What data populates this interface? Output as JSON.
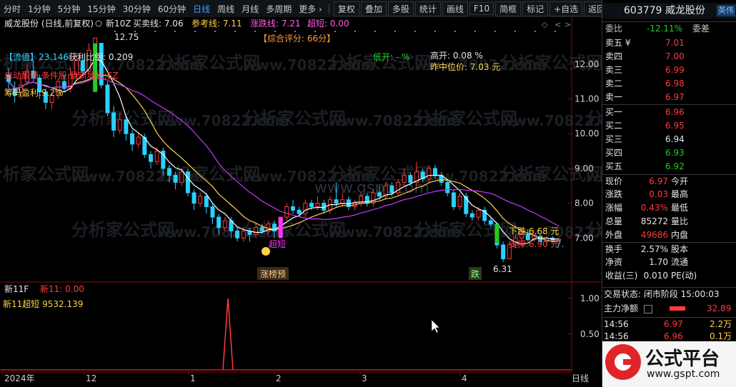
{
  "toolbar": {
    "periods": [
      "分时",
      "1分钟",
      "5分钟",
      "15分钟",
      "30分钟",
      "60分钟",
      "日线",
      "周线",
      "月线",
      "多周期",
      "更多 ›"
    ],
    "active_period": "日线",
    "tools": [
      "复权",
      "叠加",
      "多股",
      "统计",
      "画线",
      "F10",
      "简框",
      "标记",
      "+自选",
      "返回"
    ]
  },
  "chart_header": {
    "title": "威龙股份 (日线,前复权)",
    "indicator": "新10Z",
    "buy_sell_label": "买卖线: 7.06",
    "ref_label": "参考线: 7.11",
    "zdx_label": "涨跌线: 7.21",
    "super_label": "超短: 0.00"
  },
  "annotations": {
    "float_cap": "【流值】23.146",
    "profit_ratio": "获利比例: 0.209",
    "concepts": "启动酿酒 条件股 最新地址:SZ",
    "chip_profit": "筹码盈利:9.2%",
    "score": "【综合评分: 66分】",
    "low_open": "低开: - %",
    "high_open": "高开: 0.08 %",
    "prev_median": "昨中位价: 7.03 元",
    "high_mark": "12.75",
    "low_mark": "6.31",
    "super_short": "超短",
    "limit_list": "涨榜预",
    "drop_label": "跌",
    "drop_price": "下跌:6.68 元",
    "support_price": "支撑:6.90 元",
    "right_price": "7."
  },
  "watermarks": [
    "分析家公式网",
    "www.70822.com"
  ],
  "gspt_watermark": "www.gspt.com",
  "price_axis": [
    "12.00",
    "11.00",
    "10.00",
    "9.00",
    "8.00",
    "7.00"
  ],
  "sub_header": {
    "name": "新11F",
    "value": "新11: 0.00",
    "line2": "新11超短 9532.139"
  },
  "sub_axis": [
    "1.00",
    "0.50"
  ],
  "date_axis": [
    "2024年",
    "12",
    "1",
    "2",
    "3",
    "4",
    "日线"
  ],
  "quote": {
    "code_name": "603779 威龙股份",
    "badge": "英伟",
    "weibi_label": "委比",
    "weibi_value": "-12.11%",
    "weicha_label": "委差",
    "asks": [
      {
        "label": "卖五 ¥",
        "price": "7.01"
      },
      {
        "label": "卖四",
        "price": "7.00"
      },
      {
        "label": "卖三",
        "price": "6.99"
      },
      {
        "label": "卖二",
        "price": "6.98"
      },
      {
        "label": "卖一",
        "price": "6.97"
      }
    ],
    "bids": [
      {
        "label": "买一",
        "price": "6.96"
      },
      {
        "label": "买二",
        "price": "6.95"
      },
      {
        "label": "买三",
        "price": "6.94"
      },
      {
        "label": "买四",
        "price": "6.93"
      },
      {
        "label": "买五",
        "price": "6.92"
      }
    ],
    "stats": [
      {
        "l1": "现价",
        "v1": "6.97",
        "l2": "今开"
      },
      {
        "l1": "涨跌",
        "v1": "0.03",
        "l2": "最高"
      },
      {
        "l1": "涨幅",
        "v1": "0.43%",
        "l2": "最低"
      },
      {
        "l1": "总量",
        "v1": "85272",
        "l2": "量比"
      },
      {
        "l1": "外盘",
        "v1": "49686",
        "l2": "内盘"
      },
      {
        "l1": "换手",
        "v1": "2.57%",
        "l2": "股本"
      },
      {
        "l1": "净资",
        "v1": "1.70",
        "l2": "流通"
      },
      {
        "l1": "收益(三)",
        "v1": "0.010",
        "l2": "PE(动)"
      }
    ],
    "trade_status": "交易状态: 闭市阶段 15:00:03",
    "net_flow_label": "主力净额",
    "net_flow_value": "32.89",
    "ticks": [
      {
        "time": "14:56",
        "price": "6.97",
        "vol": "2.2万"
      },
      {
        "time": "14:56",
        "price": "6.96",
        "vol": "0.1万"
      }
    ],
    "logo_text": "公式平台",
    "logo_url": "www.gspt.com"
  },
  "chart_data": {
    "type": "candlestick",
    "series": [
      {
        "name": "买卖线",
        "values": []
      },
      {
        "name": "参考线",
        "values": []
      },
      {
        "name": "涨跌线",
        "values": []
      }
    ],
    "candles": [
      [
        11.7,
        11.5,
        11.9,
        11.3
      ],
      [
        11.3,
        11.1,
        11.5,
        10.9
      ],
      [
        11.2,
        11.4,
        11.6,
        11.0
      ],
      [
        11.5,
        11.8,
        12.0,
        11.4
      ],
      [
        11.8,
        11.6,
        12.1,
        11.5
      ],
      [
        11.6,
        11.2,
        11.7,
        11.0
      ],
      [
        11.2,
        10.9,
        11.3,
        10.7
      ],
      [
        10.9,
        11.1,
        11.2,
        10.7
      ],
      [
        11.1,
        11.5,
        11.6,
        11.0
      ],
      [
        11.5,
        11.3,
        11.7,
        11.2
      ],
      [
        11.3,
        11.7,
        11.9,
        11.2
      ],
      [
        11.7,
        12.1,
        12.3,
        11.6
      ],
      [
        12.1,
        11.8,
        12.3,
        11.7
      ],
      [
        11.8,
        12.4,
        12.6,
        11.7
      ],
      [
        12.4,
        12.75,
        12.75,
        12.2
      ],
      [
        12.6,
        11.4,
        12.6,
        11.3
      ],
      [
        11.4,
        10.6,
        11.5,
        10.5
      ],
      [
        10.6,
        10.1,
        10.8,
        9.9
      ],
      [
        10.1,
        10.4,
        10.6,
        10.0
      ],
      [
        10.4,
        10.0,
        10.5,
        9.8
      ],
      [
        10.0,
        9.7,
        10.1,
        9.5
      ],
      [
        9.7,
        9.9,
        10.0,
        9.6
      ],
      [
        9.9,
        9.4,
        10.0,
        9.3
      ],
      [
        9.4,
        9.2,
        9.5,
        9.0
      ],
      [
        9.2,
        9.5,
        9.6,
        9.1
      ],
      [
        9.5,
        9.0,
        9.6,
        8.8
      ],
      [
        9.0,
        8.8,
        9.1,
        8.6
      ],
      [
        8.8,
        8.6,
        8.9,
        8.4
      ],
      [
        8.6,
        8.9,
        9.0,
        8.5
      ],
      [
        8.9,
        8.3,
        9.0,
        8.2
      ],
      [
        8.3,
        8.0,
        8.4,
        7.8
      ],
      [
        8.0,
        8.2,
        8.3,
        7.9
      ],
      [
        8.2,
        7.9,
        8.3,
        7.7
      ],
      [
        7.9,
        7.6,
        8.0,
        7.4
      ],
      [
        7.6,
        7.3,
        7.7,
        7.1
      ],
      [
        7.3,
        7.5,
        7.6,
        7.2
      ],
      [
        7.5,
        7.2,
        7.6,
        7.0
      ],
      [
        7.2,
        7.0,
        7.3,
        6.9
      ],
      [
        7.0,
        7.2,
        7.3,
        6.9
      ],
      [
        7.2,
        7.1,
        7.3,
        6.9
      ],
      [
        7.1,
        7.3,
        7.4,
        7.0
      ],
      [
        7.3,
        7.2,
        7.4,
        7.1
      ],
      [
        7.2,
        7.4,
        7.5,
        7.1
      ],
      [
        7.4,
        7.2,
        7.5,
        7.0
      ],
      [
        7.1,
        7.6,
        7.6,
        7.0
      ],
      [
        7.6,
        7.9,
        8.0,
        7.5
      ],
      [
        7.9,
        7.8,
        8.1,
        7.7
      ],
      [
        7.8,
        7.7,
        7.9,
        7.6
      ],
      [
        7.7,
        8.0,
        8.1,
        7.6
      ],
      [
        8.0,
        7.9,
        8.1,
        7.8
      ],
      [
        7.9,
        8.0,
        8.2,
        7.8
      ],
      [
        8.0,
        7.8,
        8.1,
        7.7
      ],
      [
        7.8,
        8.1,
        8.2,
        7.7
      ],
      [
        8.1,
        8.0,
        8.6,
        7.9
      ],
      [
        8.0,
        8.1,
        8.3,
        7.9
      ],
      [
        8.1,
        7.9,
        8.2,
        7.8
      ],
      [
        7.9,
        8.0,
        8.1,
        7.8
      ],
      [
        8.0,
        8.2,
        8.3,
        7.9
      ],
      [
        8.2,
        8.0,
        8.3,
        7.9
      ],
      [
        8.0,
        8.3,
        8.4,
        7.9
      ],
      [
        8.3,
        8.2,
        8.5,
        8.1
      ],
      [
        8.2,
        8.5,
        8.6,
        8.1
      ],
      [
        8.5,
        8.3,
        8.6,
        8.2
      ],
      [
        8.3,
        8.6,
        8.7,
        8.2
      ],
      [
        8.6,
        8.8,
        9.0,
        8.5
      ],
      [
        8.8,
        8.6,
        8.9,
        8.5
      ],
      [
        8.6,
        8.9,
        9.2,
        8.5
      ],
      [
        8.9,
        8.7,
        9.0,
        8.6
      ],
      [
        8.7,
        9.0,
        9.1,
        8.6
      ],
      [
        9.0,
        8.8,
        9.1,
        8.7
      ],
      [
        8.8,
        8.6,
        8.9,
        8.5
      ],
      [
        8.6,
        8.3,
        8.7,
        8.2
      ],
      [
        8.3,
        7.9,
        8.4,
        7.8
      ],
      [
        7.9,
        8.2,
        8.3,
        7.8
      ],
      [
        8.2,
        7.7,
        8.3,
        7.6
      ],
      [
        7.7,
        7.6,
        7.8,
        7.5
      ],
      [
        7.6,
        7.8,
        7.9,
        7.5
      ],
      [
        7.8,
        7.5,
        7.9,
        7.4
      ],
      [
        7.5,
        7.4,
        7.6,
        7.3
      ],
      [
        7.4,
        6.8,
        7.4,
        6.7
      ],
      [
        6.8,
        6.4,
        6.9,
        6.31
      ],
      [
        6.4,
        6.8,
        6.9,
        6.4
      ],
      [
        6.8,
        7.0,
        7.1,
        6.7
      ],
      [
        7.0,
        7.1,
        7.2,
        6.9
      ],
      [
        7.1,
        6.95,
        7.2,
        6.9
      ],
      [
        6.95,
        7.05,
        7.1,
        6.9
      ],
      [
        7.05,
        6.9,
        7.1,
        6.85
      ],
      [
        6.9,
        7.0,
        7.05,
        6.85
      ],
      [
        7.0,
        6.94,
        7.05,
        6.9
      ],
      [
        6.94,
        6.97,
        7.02,
        6.9
      ]
    ],
    "ylim": [
      6.0,
      12.9
    ],
    "xlabel": "",
    "ylabel": ""
  }
}
